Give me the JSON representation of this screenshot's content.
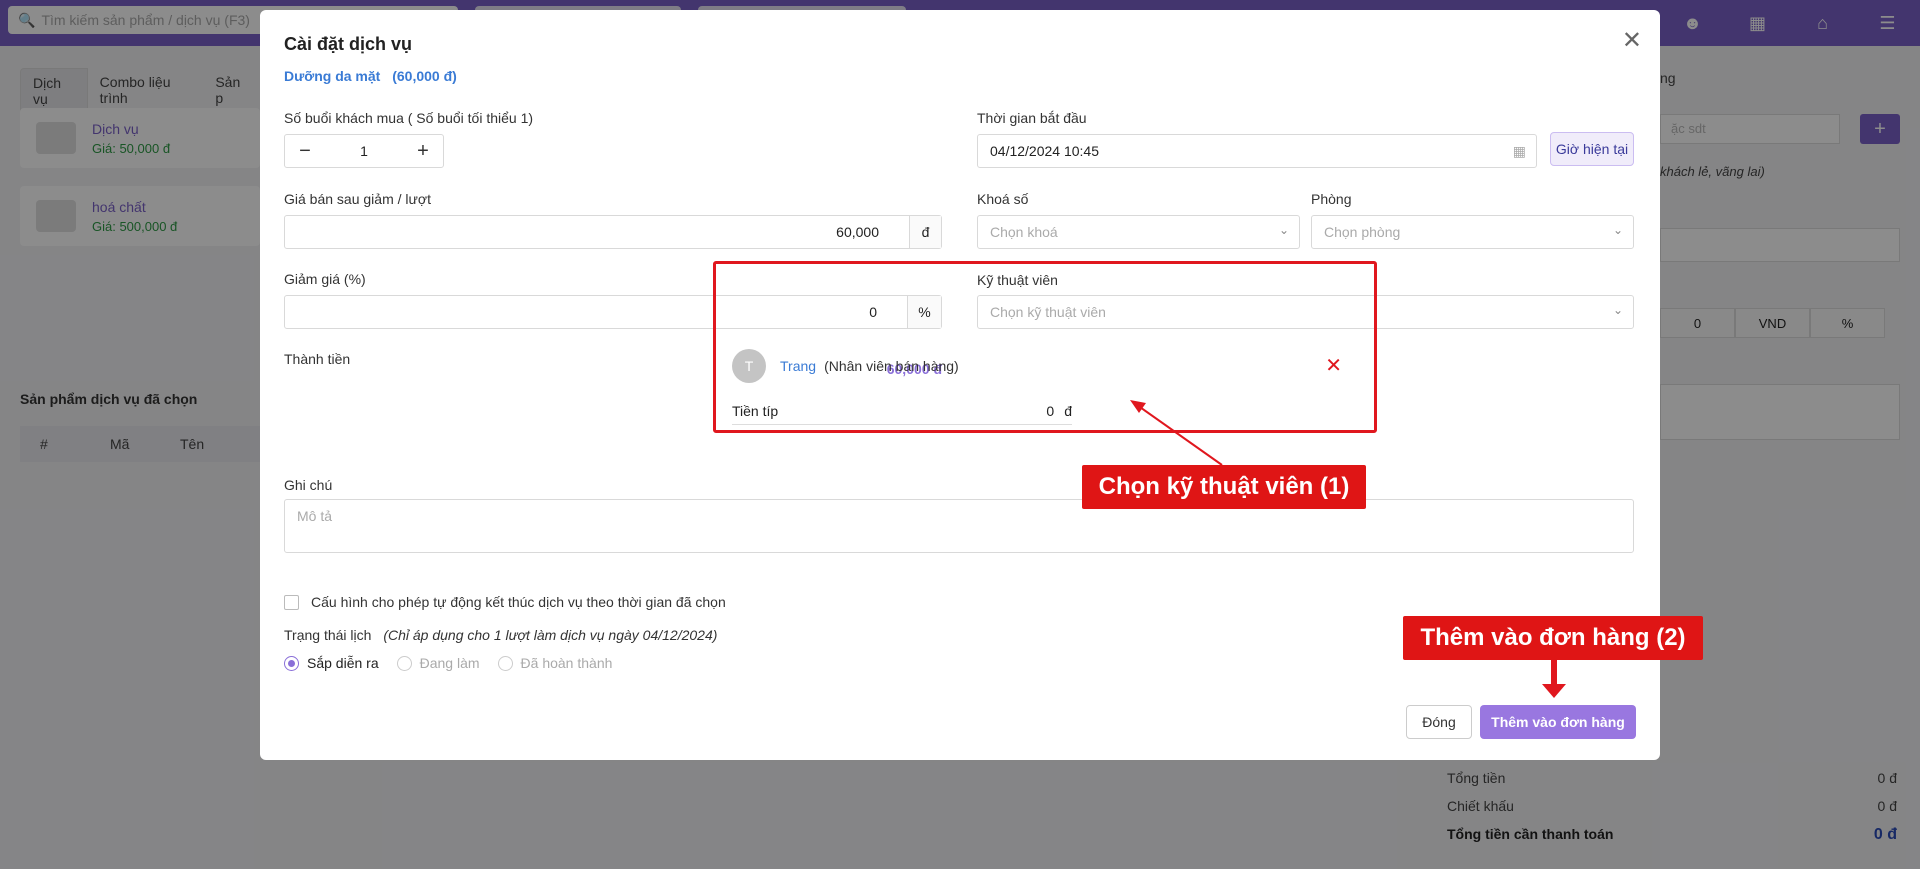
{
  "topbar": {
    "search_placeholder": "Tìm kiếm sản phẩm / dịch vụ (F3)",
    "icons": [
      "user-icon",
      "store-icon",
      "home-icon",
      "menu-icon"
    ]
  },
  "left_panel": {
    "tabs": [
      "Dịch vụ",
      "Combo liệu trình",
      "Sản p"
    ],
    "products": [
      {
        "name": "Dịch vụ",
        "price": "Giá: 50,000 đ"
      },
      {
        "name": "hoá chất",
        "price": "Giá: 500,000 đ"
      }
    ],
    "selected_title": "Sản phẩm dịch vụ đã chọn",
    "table_headers": [
      "#",
      "Mã",
      "Tên"
    ]
  },
  "right_panel": {
    "label_top": "ng",
    "customer_placeholder": "ặc sdt",
    "customer_note": "khách lẻ, vãng lai)",
    "segments": [
      "0",
      "VND",
      "%"
    ],
    "totals": [
      {
        "label": "Tổng tiền",
        "value": "0 đ"
      },
      {
        "label": "Chiết khấu",
        "value": "0 đ"
      },
      {
        "label": "Tổng tiền cần thanh toán",
        "value": "0 đ"
      }
    ]
  },
  "modal": {
    "title": "Cài đặt dịch vụ",
    "service_name": "Dưỡng da mặt",
    "service_price": "(60,000 đ)",
    "sessions_label": "Số buổi khách mua ( Số buổi tối thiểu 1)",
    "sessions_value": "1",
    "price_label": "Giá bán sau giảm / lượt",
    "price_value": "60,000",
    "price_unit": "đ",
    "discount_label": "Giảm giá (%)",
    "discount_value": "0",
    "discount_unit": "%",
    "total_label": "Thành tiền",
    "total_value": "60,000 đ",
    "start_label": "Thời gian bắt đầu",
    "start_value": "04/12/2024  10:45",
    "now_button": "Giờ hiện tại",
    "course_label": "Khoá số",
    "course_placeholder": "Chọn khoá",
    "room_label": "Phòng",
    "room_placeholder": "Chọn phòng",
    "tech_label": "Kỹ thuật viên",
    "tech_placeholder": "Chọn kỹ thuật viên",
    "tech": {
      "initial": "T",
      "name": "Trang",
      "role": "(Nhân viên bán hàng)",
      "tip_label": "Tiền típ",
      "tip_value": "0",
      "tip_unit": "đ"
    },
    "note_label": "Ghi chú",
    "note_placeholder": "Mô tả",
    "auto_finish_label": "Cấu hình cho phép tự động kết thúc dịch vụ theo thời gian đã chọn",
    "status_label": "Trạng thái lịch",
    "status_note": "(Chỉ áp dụng cho 1 lượt làm dịch vụ ngày 04/12/2024)",
    "status_options": [
      "Sắp diễn ra",
      "Đang làm",
      "Đã hoàn thành"
    ],
    "status_selected": "Sắp diễn ra",
    "close_button": "Đóng",
    "add_button": "Thêm vào đơn hàng"
  },
  "annotations": {
    "callout_1": "Chọn kỹ thuật viên (1)",
    "callout_2": "Thêm vào đơn hàng (2)",
    "highlight_color": "#e0171e"
  }
}
